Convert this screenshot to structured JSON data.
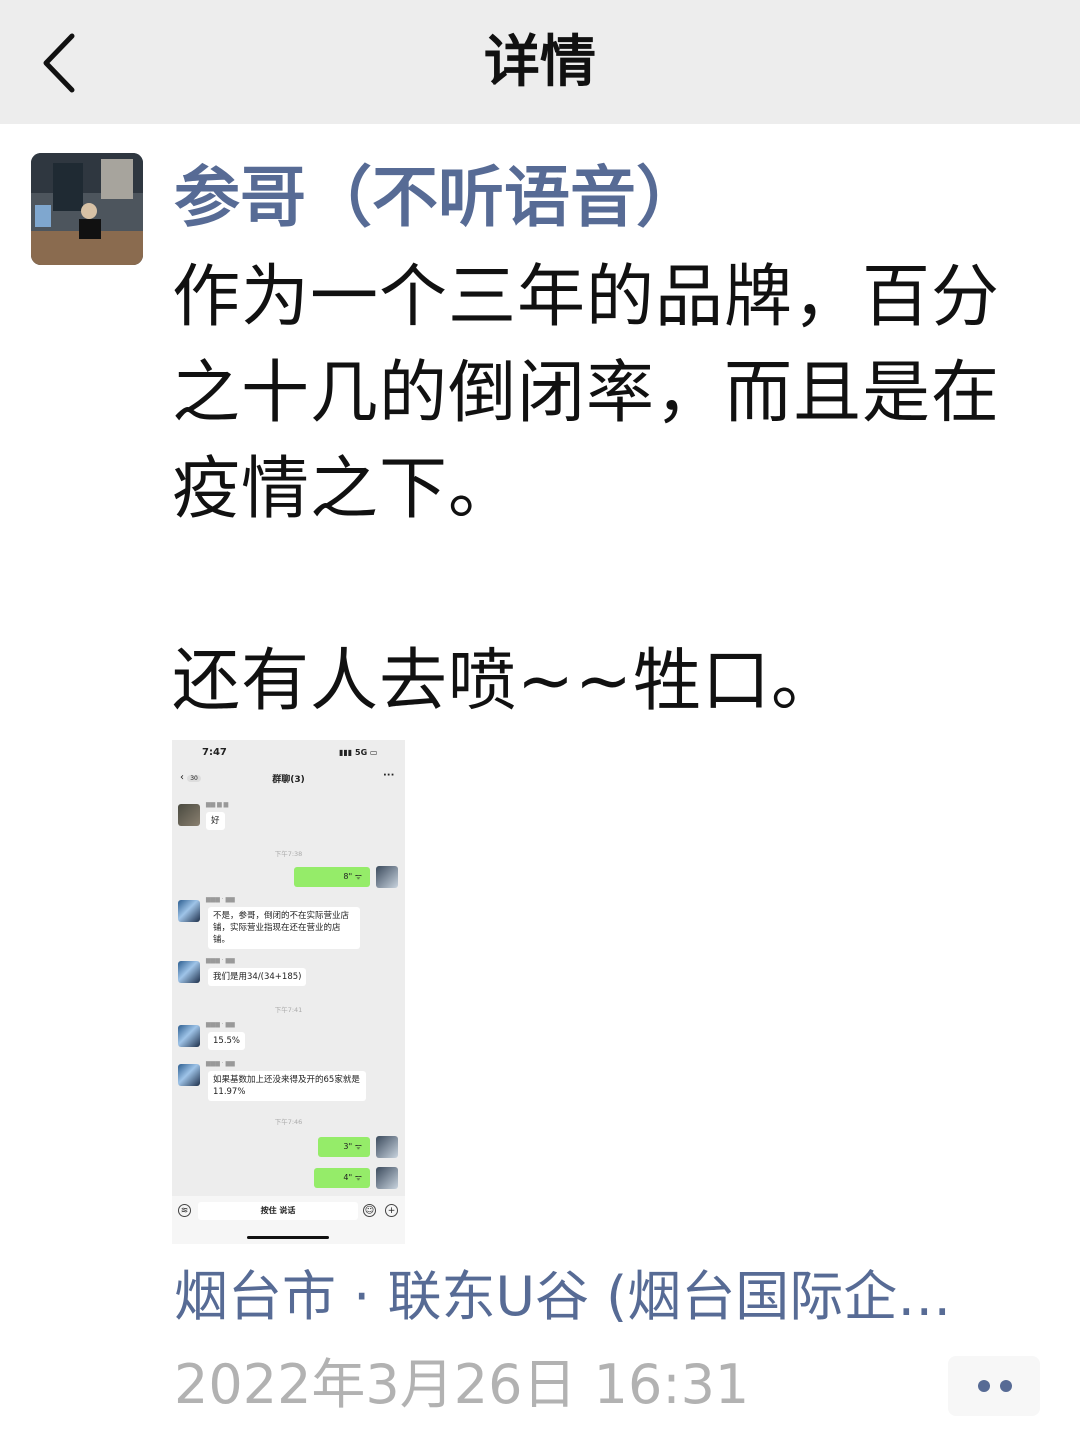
{
  "nav": {
    "title": "详情",
    "back_icon": "chevron-left-icon"
  },
  "post": {
    "author": "参哥（不听语音）",
    "text": "作为一个三年的品牌，百分之十几的倒闭率，而且是在疫情之下。\n\n还有人去喷~~牲口。",
    "location": "烟台市 · 联东U谷 (烟台国际企…",
    "time": "2022年3月26日 16:31"
  },
  "screenshot": {
    "status_time": "7:47",
    "status_signal": "5G",
    "title": "群聊(3)",
    "back_count": "30",
    "messages": [
      {
        "side": "left",
        "text": "好"
      },
      {
        "timestamp": "下午7:38"
      },
      {
        "side": "right",
        "voice": "8\""
      },
      {
        "side": "left",
        "text": "不是，参哥，倒闭的不在实际营业店铺，实际营业指现在还在营业的店铺。"
      },
      {
        "side": "left",
        "text": "我们是用34/(34+185)"
      },
      {
        "timestamp": "下午7:41"
      },
      {
        "side": "left",
        "text": "15.5%"
      },
      {
        "side": "left",
        "text": "如果基数加上还没来得及开的65家就是11.97%"
      },
      {
        "timestamp": "下午7:46"
      },
      {
        "side": "right",
        "voice": "3\""
      },
      {
        "side": "right",
        "voice": "4\""
      }
    ],
    "input_label": "按住 说话"
  },
  "colors": {
    "link": "#576b95",
    "navbar": "#ededed",
    "time": "#b2b2b2"
  }
}
